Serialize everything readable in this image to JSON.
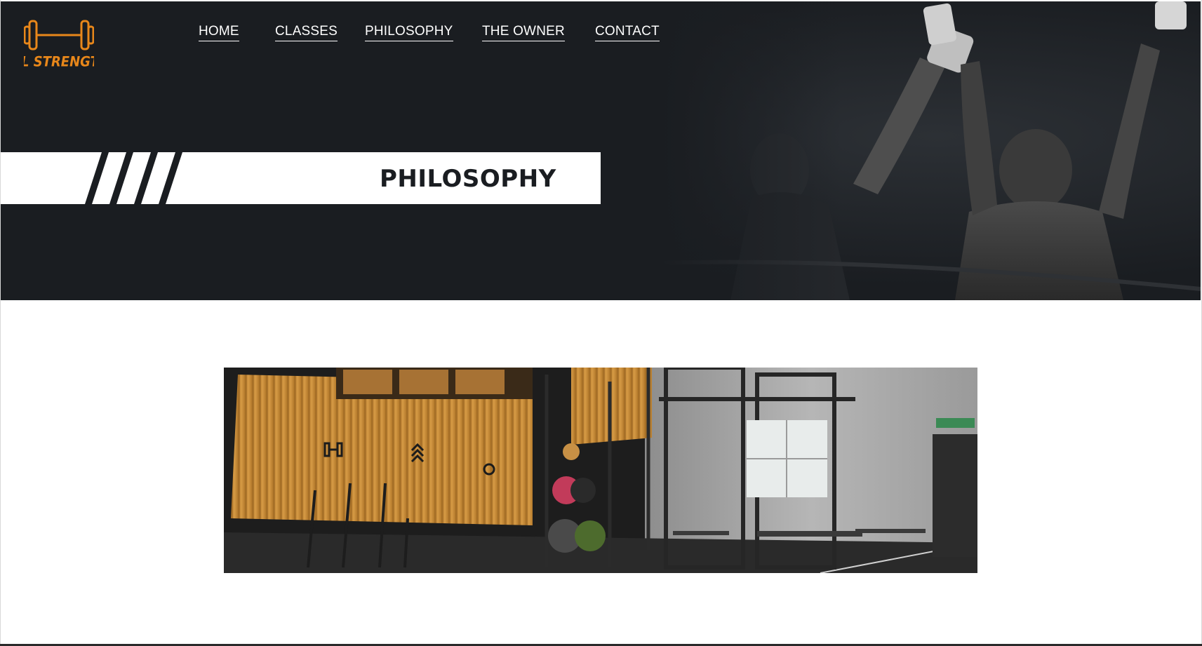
{
  "brand": {
    "logo_text": "ML STRENGTH",
    "accent": "#e8871a"
  },
  "nav": {
    "items": [
      {
        "label": "HOME"
      },
      {
        "label": "CLASSES"
      },
      {
        "label": "PHILOSOPHY"
      },
      {
        "label": "THE OWNER"
      },
      {
        "label": "CONTACT"
      }
    ]
  },
  "hero": {
    "title": "PHILOSOPHY",
    "background": "#1a1d21"
  },
  "gym_image": {
    "wall_color": "#c88a35"
  }
}
